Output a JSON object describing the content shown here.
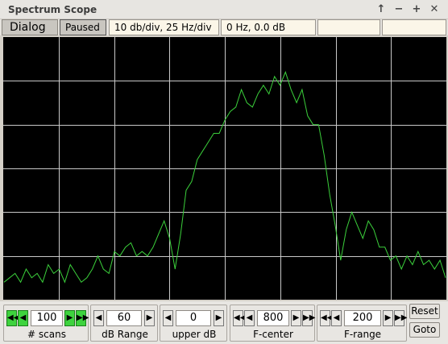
{
  "window": {
    "title": "Spectrum Scope",
    "buttons": [
      "↑",
      "−",
      "+",
      "✕"
    ]
  },
  "toolbar": {
    "dialog_label": "Dialog",
    "paused_label": "Paused",
    "scale_text": "10 db/div, 25 Hz/div",
    "cursor_text": "0 Hz, 0.0 dB",
    "field5": "",
    "field6": ""
  },
  "chart_data": {
    "type": "line",
    "title": "",
    "xlabel": "",
    "ylabel": "",
    "grid": true,
    "grid_divisions": {
      "x": 8,
      "y": 6
    },
    "colors": {
      "background": "#000000",
      "grid": "#c8c8c8",
      "trace": "#3bd03b"
    },
    "series": [
      {
        "x": [
          0,
          1,
          2,
          3,
          4,
          5,
          6,
          7,
          8,
          9,
          10,
          11,
          12,
          13,
          14,
          15,
          16,
          17,
          18,
          19,
          20,
          21,
          22,
          23,
          24,
          25,
          26,
          27,
          28,
          29,
          30,
          31,
          32,
          33,
          34,
          35,
          36,
          37,
          38,
          39,
          40,
          41,
          42,
          43,
          44,
          45,
          46,
          47,
          48,
          49,
          50,
          51,
          52,
          53,
          54,
          55,
          56,
          57,
          58,
          59,
          60,
          61,
          62,
          63,
          64,
          65,
          66,
          67,
          68,
          69,
          70,
          71,
          72,
          73,
          74,
          75,
          76,
          77,
          78,
          79,
          80
        ],
        "values": [
          -56,
          -55,
          -54,
          -56,
          -53,
          -55,
          -54,
          -56,
          -52,
          -54,
          -53,
          -56,
          -52,
          -54,
          -56,
          -55,
          -53,
          -50,
          -53,
          -54,
          -49,
          -50,
          -48,
          -47,
          -50,
          -49,
          -50,
          -48,
          -45,
          -42,
          -46,
          -53,
          -45,
          -35,
          -33,
          -28,
          -26,
          -24,
          -22,
          -22,
          -19,
          -17,
          -16,
          -12,
          -15,
          -16,
          -13,
          -11,
          -13,
          -9,
          -11,
          -8,
          -12,
          -15,
          -12,
          -18,
          -20,
          -20,
          -27,
          -36,
          -43,
          -51,
          -44,
          -40,
          -43,
          -46,
          -42,
          -44,
          -48,
          -48,
          -51,
          -50,
          -53,
          -50,
          -52,
          -49,
          -52,
          -51,
          -53,
          -51,
          -55
        ]
      }
    ]
  },
  "controls": {
    "scans": {
      "value": "100",
      "label": "# scans"
    },
    "db_range": {
      "value": "60",
      "label": "dB Range"
    },
    "upper_db": {
      "value": "0",
      "label": "upper dB"
    },
    "f_center": {
      "value": "800",
      "label": "F-center"
    },
    "f_range": {
      "value": "200",
      "label": "F-range"
    },
    "reset_label": "Reset",
    "goto_label": "Goto"
  }
}
